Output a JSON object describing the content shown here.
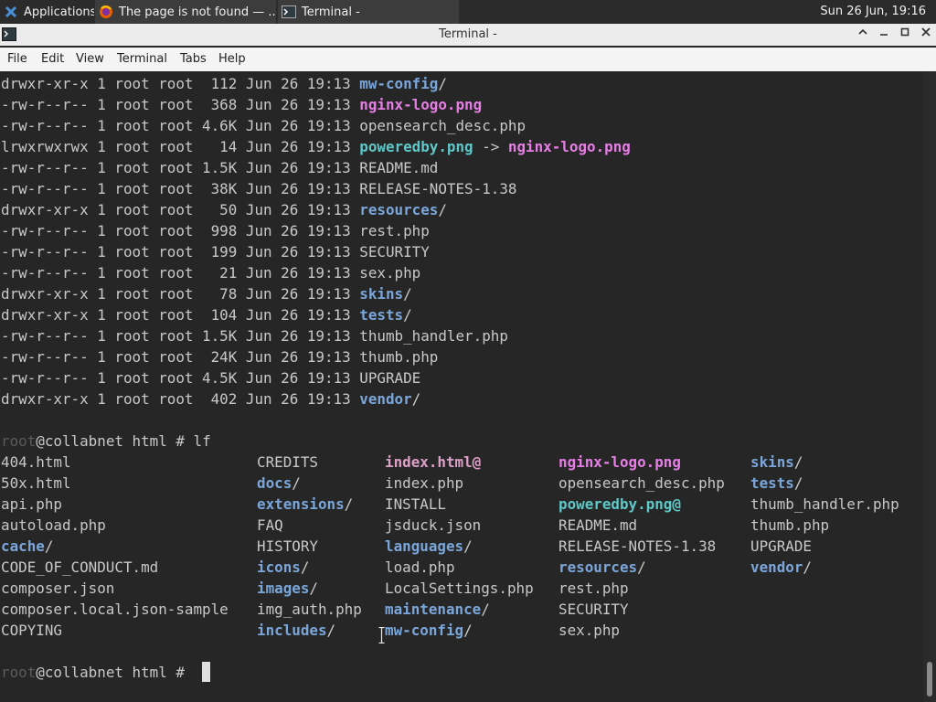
{
  "panel": {
    "apps_label": "Applications",
    "tasks": [
      {
        "label": "The page is not found — ..."
      },
      {
        "label": "Terminal -"
      }
    ],
    "clock": "Sun 26 Jun, 19:16"
  },
  "window": {
    "title": "Terminal -"
  },
  "menu": {
    "items": [
      "File",
      "Edit",
      "View",
      "Terminal",
      "Tabs",
      "Help"
    ]
  },
  "colors": {
    "directory": "#7aa6da",
    "image": "#e67ee6",
    "symlink": "#5ec8c8",
    "background": "#262626",
    "text": "#c8c8c8"
  },
  "listing": [
    {
      "perm": "drwxr-xr-x",
      "links": "1",
      "owner": "root",
      "group": "root",
      "size": "112",
      "date": "Jun 26 19:13",
      "name": "mw-config",
      "suffix": "/",
      "kind": "dir"
    },
    {
      "perm": "-rw-r--r--",
      "links": "1",
      "owner": "root",
      "group": "root",
      "size": "368",
      "date": "Jun 26 19:13",
      "name": "nginx-logo.png",
      "suffix": "",
      "kind": "img"
    },
    {
      "perm": "-rw-r--r--",
      "links": "1",
      "owner": "root",
      "group": "root",
      "size": "4.6K",
      "date": "Jun 26 19:13",
      "name": "opensearch_desc.php",
      "suffix": "",
      "kind": "file"
    },
    {
      "perm": "lrwxrwxrwx",
      "links": "1",
      "owner": "root",
      "group": "root",
      "size": "14",
      "date": "Jun 26 19:13",
      "name": "poweredby.png",
      "suffix": "",
      "kind": "lnk",
      "arrow": " -> ",
      "target": "nginx-logo.png"
    },
    {
      "perm": "-rw-r--r--",
      "links": "1",
      "owner": "root",
      "group": "root",
      "size": "1.5K",
      "date": "Jun 26 19:13",
      "name": "README.md",
      "suffix": "",
      "kind": "file"
    },
    {
      "perm": "-rw-r--r--",
      "links": "1",
      "owner": "root",
      "group": "root",
      "size": "38K",
      "date": "Jun 26 19:13",
      "name": "RELEASE-NOTES-1.38",
      "suffix": "",
      "kind": "file"
    },
    {
      "perm": "drwxr-xr-x",
      "links": "1",
      "owner": "root",
      "group": "root",
      "size": "50",
      "date": "Jun 26 19:13",
      "name": "resources",
      "suffix": "/",
      "kind": "dir"
    },
    {
      "perm": "-rw-r--r--",
      "links": "1",
      "owner": "root",
      "group": "root",
      "size": "998",
      "date": "Jun 26 19:13",
      "name": "rest.php",
      "suffix": "",
      "kind": "file"
    },
    {
      "perm": "-rw-r--r--",
      "links": "1",
      "owner": "root",
      "group": "root",
      "size": "199",
      "date": "Jun 26 19:13",
      "name": "SECURITY",
      "suffix": "",
      "kind": "file"
    },
    {
      "perm": "-rw-r--r--",
      "links": "1",
      "owner": "root",
      "group": "root",
      "size": "21",
      "date": "Jun 26 19:13",
      "name": "sex.php",
      "suffix": "",
      "kind": "file"
    },
    {
      "perm": "drwxr-xr-x",
      "links": "1",
      "owner": "root",
      "group": "root",
      "size": "78",
      "date": "Jun 26 19:13",
      "name": "skins",
      "suffix": "/",
      "kind": "dir"
    },
    {
      "perm": "drwxr-xr-x",
      "links": "1",
      "owner": "root",
      "group": "root",
      "size": "104",
      "date": "Jun 26 19:13",
      "name": "tests",
      "suffix": "/",
      "kind": "dir"
    },
    {
      "perm": "-rw-r--r--",
      "links": "1",
      "owner": "root",
      "group": "root",
      "size": "1.5K",
      "date": "Jun 26 19:13",
      "name": "thumb_handler.php",
      "suffix": "",
      "kind": "file"
    },
    {
      "perm": "-rw-r--r--",
      "links": "1",
      "owner": "root",
      "group": "root",
      "size": "24K",
      "date": "Jun 26 19:13",
      "name": "thumb.php",
      "suffix": "",
      "kind": "file"
    },
    {
      "perm": "-rw-r--r--",
      "links": "1",
      "owner": "root",
      "group": "root",
      "size": "4.5K",
      "date": "Jun 26 19:13",
      "name": "UPGRADE",
      "suffix": "",
      "kind": "file"
    },
    {
      "perm": "drwxr-xr-x",
      "links": "1",
      "owner": "root",
      "group": "root",
      "size": "402",
      "date": "Jun 26 19:13",
      "name": "vendor",
      "suffix": "/",
      "kind": "dir"
    }
  ],
  "prompt": {
    "user": "root",
    "host": "@collabnet",
    "dir": " html # ",
    "command": "lf"
  },
  "columns": [
    [
      {
        "name": "404.html",
        "suffix": "",
        "kind": "file"
      },
      {
        "name": "50x.html",
        "suffix": "",
        "kind": "file"
      },
      {
        "name": "api.php",
        "suffix": "",
        "kind": "file"
      },
      {
        "name": "autoload.php",
        "suffix": "",
        "kind": "file"
      },
      {
        "name": "cache",
        "suffix": "/",
        "kind": "dir"
      },
      {
        "name": "CODE_OF_CONDUCT.md",
        "suffix": "",
        "kind": "file"
      },
      {
        "name": "composer.json",
        "suffix": "",
        "kind": "file"
      },
      {
        "name": "composer.local.json-sample",
        "suffix": "",
        "kind": "file"
      },
      {
        "name": "COPYING",
        "suffix": "",
        "kind": "file"
      }
    ],
    [
      {
        "name": "CREDITS",
        "suffix": "",
        "kind": "file"
      },
      {
        "name": "docs",
        "suffix": "/",
        "kind": "dir"
      },
      {
        "name": "extensions",
        "suffix": "/",
        "kind": "dir"
      },
      {
        "name": "FAQ",
        "suffix": "",
        "kind": "file"
      },
      {
        "name": "HISTORY",
        "suffix": "",
        "kind": "file"
      },
      {
        "name": "icons",
        "suffix": "/",
        "kind": "dir"
      },
      {
        "name": "images",
        "suffix": "/",
        "kind": "dir"
      },
      {
        "name": "img_auth.php",
        "suffix": "",
        "kind": "file"
      },
      {
        "name": "includes",
        "suffix": "/",
        "kind": "dir"
      }
    ],
    [
      {
        "name": "index.html",
        "suffix": "@",
        "kind": "lnkbroken"
      },
      {
        "name": "index.php",
        "suffix": "",
        "kind": "file"
      },
      {
        "name": "INSTALL",
        "suffix": "",
        "kind": "file"
      },
      {
        "name": "jsduck.json",
        "suffix": "",
        "kind": "file"
      },
      {
        "name": "languages",
        "suffix": "/",
        "kind": "dir"
      },
      {
        "name": "load.php",
        "suffix": "",
        "kind": "file"
      },
      {
        "name": "LocalSettings.php",
        "suffix": "",
        "kind": "file"
      },
      {
        "name": "maintenance",
        "suffix": "/",
        "kind": "dir"
      },
      {
        "name": "mw-config",
        "suffix": "/",
        "kind": "dir"
      }
    ],
    [
      {
        "name": "nginx-logo.png",
        "suffix": "",
        "kind": "img"
      },
      {
        "name": "opensearch_desc.php",
        "suffix": "",
        "kind": "file"
      },
      {
        "name": "poweredby.png",
        "suffix": "@",
        "kind": "lnk"
      },
      {
        "name": "README.md",
        "suffix": "",
        "kind": "file"
      },
      {
        "name": "RELEASE-NOTES-1.38",
        "suffix": "",
        "kind": "file"
      },
      {
        "name": "resources",
        "suffix": "/",
        "kind": "dir"
      },
      {
        "name": "rest.php",
        "suffix": "",
        "kind": "file"
      },
      {
        "name": "SECURITY",
        "suffix": "",
        "kind": "file"
      },
      {
        "name": "sex.php",
        "suffix": "",
        "kind": "file"
      }
    ],
    [
      {
        "name": "skins",
        "suffix": "/",
        "kind": "dir"
      },
      {
        "name": "tests",
        "suffix": "/",
        "kind": "dir"
      },
      {
        "name": "thumb_handler.php",
        "suffix": "",
        "kind": "file"
      },
      {
        "name": "thumb.php",
        "suffix": "",
        "kind": "file"
      },
      {
        "name": "UPGRADE",
        "suffix": "",
        "kind": "file"
      },
      {
        "name": "vendor",
        "suffix": "/",
        "kind": "dir"
      }
    ]
  ]
}
